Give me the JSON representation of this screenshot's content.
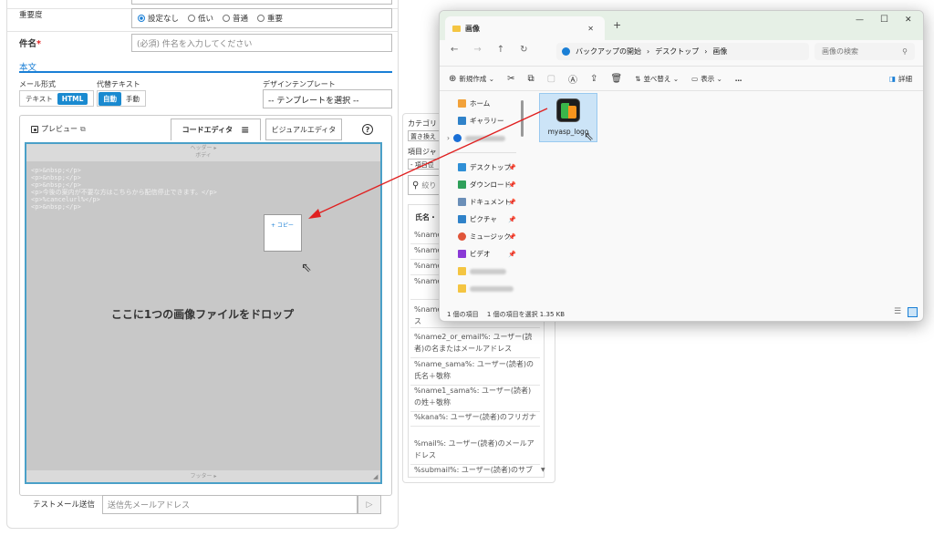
{
  "form": {
    "importance_label": "重要度",
    "importance_options": [
      "設定なし",
      "低い",
      "普通",
      "重要"
    ],
    "subject_label": "件名",
    "required_mark": "*",
    "subject_placeholder": "(必須) 件名を入力してください",
    "body_label": "本文",
    "mail_format_label": "メール形式",
    "mail_format_options": [
      "テキスト",
      "HTML"
    ],
    "alt_text_label": "代替テキスト",
    "alt_text_options": [
      "自動",
      "手動"
    ],
    "design_template_label": "デザインテンプレート",
    "design_template_value": "-- テンプレートを選択 --",
    "preview_label": "プレビュー",
    "code_editor_tab": "コードエディタ",
    "visual_editor_tab": "ビジュアルエディタ",
    "help_icon": "?",
    "header_label": "ヘッダー ▸",
    "body_section_label": "ボディ",
    "code_lines": [
      "<p>&nbsp;</p>",
      "<p>&nbsp;</p>",
      "<p>&nbsp;</p>",
      "<p>今後の案内が不要な方はこちらから配信停止できます。</p>",
      "<p>%cancelurl%</p>",
      "<p>&nbsp;</p>"
    ],
    "copy_badge": "+ コピー",
    "drop_text": "ここに1つの画像ファイルをドロップ",
    "footer_label": "フッター ▸",
    "test_mail_label": "テストメール送信",
    "test_mail_placeholder": "送信先メールアドレス"
  },
  "category_panel": {
    "title": "カテゴリ",
    "replace_label": "置き換え",
    "item_label": "項目ジャ",
    "select_value": "- 項目位",
    "search_placeholder": "絞り",
    "header": "氏名・",
    "vars": [
      "%name",
      "%name",
      "%name",
      "%name 者)の氏",
      "%name 者)の姓またはメールアドレス",
      "%name2_or_email%: ユーザー(読者)の名またはメールアドレス",
      "%name_sama%: ユーザー(読者)の氏名＋敬称",
      "%name1_sama%: ユーザー(読者)の姓＋敬称",
      "%kana%: ユーザー(読者)のフリガナ",
      "%mail%: ユーザー(読者)のメールアドレス",
      "%submail%: ユーザー(読者)のサブ"
    ]
  },
  "explorer": {
    "tab_title": "画像",
    "new_tab": "+",
    "breadcrumb": [
      "バックアップの開始",
      "デスクトップ",
      "画像"
    ],
    "search_placeholder": "画像の検索",
    "toolbar": {
      "new": "新規作成",
      "sort": "並べ替え",
      "view": "表示",
      "more": "…",
      "details": "詳細"
    },
    "sidebar": [
      "ホーム",
      "ギャラリー",
      "デスクトップ",
      "ダウンロード",
      "ドキュメント",
      "ピクチャ",
      "ミュージック",
      "ビデオ"
    ],
    "file_name": "myasp_logo",
    "status": "1 個の項目　 1 個の項目を選択 1.35 KB"
  },
  "colors": {
    "accent": "#1a8ad0",
    "drop_bg": "#c8c8c8",
    "arrow": "#e02020",
    "logo_green": "#3ab54a",
    "logo_orange": "#f7941d"
  }
}
